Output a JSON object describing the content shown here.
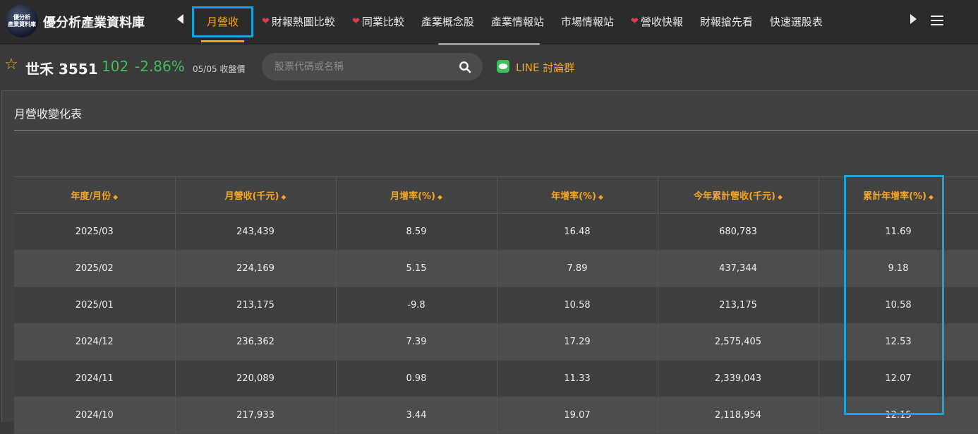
{
  "header": {
    "logo_line1": "優分析",
    "logo_line2": "產業資料庫",
    "site_title": "優分析產業資料庫",
    "nav_items": [
      {
        "label": "月營收",
        "active": true,
        "heart": false
      },
      {
        "label": "財報熱圖比較",
        "active": false,
        "heart": true
      },
      {
        "label": "同業比較",
        "active": false,
        "heart": true
      },
      {
        "label": "產業概念股",
        "active": false,
        "heart": false
      },
      {
        "label": "產業情報站",
        "active": false,
        "heart": false
      },
      {
        "label": "市場情報站",
        "active": false,
        "heart": false
      },
      {
        "label": "營收快報",
        "active": false,
        "heart": true
      },
      {
        "label": "財報搶先看",
        "active": false,
        "heart": false
      },
      {
        "label": "快速選股表",
        "active": false,
        "heart": false
      }
    ]
  },
  "stock": {
    "name_code": "世禾 3551",
    "price": "102",
    "change": "-2.86%",
    "date_label": "05/05 收盤價",
    "search_placeholder": "股票代碼或名稱",
    "line_label": "LINE 討論群"
  },
  "panel": {
    "title": "月營收變化表"
  },
  "table": {
    "headers": [
      "年度/月份",
      "月營收(千元)",
      "月增率(%)",
      "年增率(%)",
      "今年累計營收(千元)",
      "累計年增率(%)"
    ],
    "rows": [
      [
        "2025/03",
        "243,439",
        "8.59",
        "16.48",
        "680,783",
        "11.69"
      ],
      [
        "2025/02",
        "224,169",
        "5.15",
        "7.89",
        "437,344",
        "9.18"
      ],
      [
        "2025/01",
        "213,175",
        "-9.8",
        "10.58",
        "213,175",
        "10.58"
      ],
      [
        "2024/12",
        "236,362",
        "7.39",
        "17.29",
        "2,575,405",
        "12.53"
      ],
      [
        "2024/11",
        "220,089",
        "0.98",
        "11.33",
        "2,339,043",
        "12.07"
      ],
      [
        "2024/10",
        "217,933",
        "3.44",
        "19.07",
        "2,118,954",
        "12.15"
      ]
    ]
  },
  "colors": {
    "accent": "#f5a623",
    "highlight": "#1aa3d6",
    "positive": "#3fbf5a"
  }
}
